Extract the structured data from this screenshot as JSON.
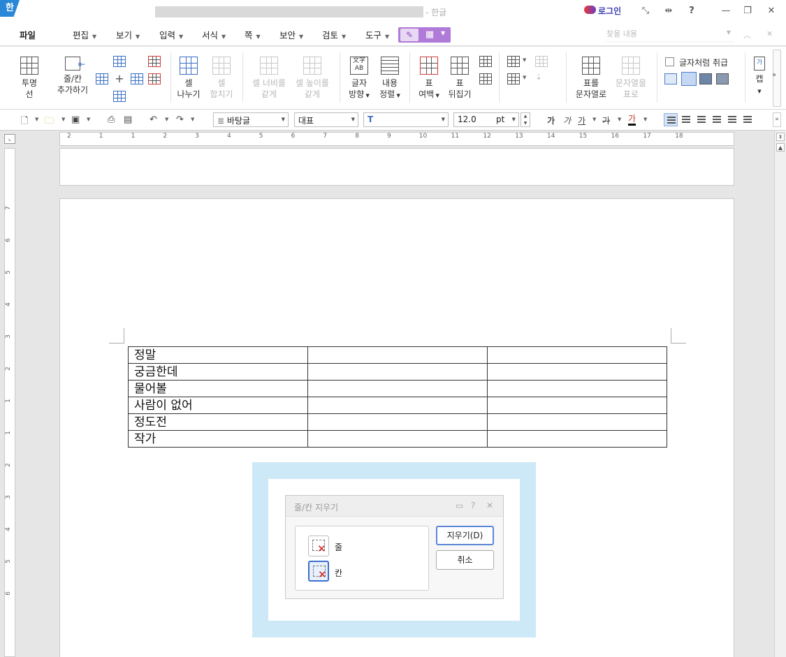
{
  "titlebar": {
    "app_logo": "한",
    "app_name": "- 한글",
    "login": "로그인",
    "buttons": [
      "⤡",
      "⇹",
      "?",
      "—",
      "❐",
      "✕"
    ]
  },
  "menubar": {
    "file": "파일",
    "items": [
      "편집",
      "보기",
      "입력",
      "서식",
      "쪽",
      "보안",
      "검토",
      "도구"
    ],
    "find_placeholder": "찾을 내용",
    "accent": "#b07ad8"
  },
  "ribbon": {
    "transparent_lines": [
      "투명",
      "선"
    ],
    "add_rowcol": [
      "줄/칸",
      "추가하기"
    ],
    "split_cells": [
      "셀",
      "나누기"
    ],
    "merge_cells": [
      "셀",
      "합치기"
    ],
    "equal_width": [
      "셀 너비를",
      "같게"
    ],
    "equal_height": [
      "셀 높이를",
      "같게"
    ],
    "text_direction": [
      "글자",
      "방향"
    ],
    "content_align": [
      "내용",
      "정렬"
    ],
    "table_margin": [
      "표",
      "여백"
    ],
    "table_flip": [
      "표",
      "뒤집기"
    ],
    "table_to_text": [
      "표를",
      "문자열로"
    ],
    "text_to_table": [
      "문자열을",
      "표로"
    ],
    "treat_as_char": "글자처럼 취급",
    "caption": [
      "가",
      "캡"
    ]
  },
  "format_toolbar": {
    "style": "바탕글",
    "font_lang": "대표",
    "font": "",
    "font_size": "12.0",
    "font_unit": "pt",
    "bold": "가",
    "italic": "가",
    "underline": "가",
    "strike": "가",
    "color": "가"
  },
  "ruler": {
    "h_ticks": [
      "2",
      "1",
      "1",
      "2",
      "3",
      "4",
      "5",
      "6",
      "7",
      "8",
      "9",
      "10",
      "11",
      "12",
      "13",
      "14",
      "15",
      "16",
      "17",
      "18"
    ],
    "v_ticks": [
      "7",
      "6",
      "5",
      "4",
      "3",
      "2",
      "1",
      "1",
      "2",
      "3",
      "4",
      "5",
      "6"
    ]
  },
  "document": {
    "table_rows": [
      [
        "정말",
        "",
        ""
      ],
      [
        "궁금한데",
        "",
        ""
      ],
      [
        "물어볼",
        "",
        ""
      ],
      [
        "사람이 없어",
        "",
        ""
      ],
      [
        "정도전",
        "",
        ""
      ],
      [
        "작가",
        "",
        ""
      ]
    ]
  },
  "dialog": {
    "title": "줄/칸 지우기",
    "option_row": "줄",
    "option_col": "칸",
    "selected": "칸",
    "delete_button": "지우기(D)",
    "cancel_button": "취소",
    "highlight_color": "#cde9f7"
  }
}
